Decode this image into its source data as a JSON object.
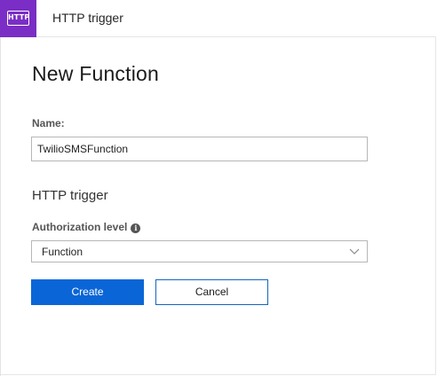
{
  "header": {
    "logo_text": "HTTP",
    "title": "HTTP trigger"
  },
  "form": {
    "page_title": "New Function",
    "name_label": "Name:",
    "name_value": "TwilioSMSFunction",
    "section_title": "HTTP trigger",
    "auth_label": "Authorization level",
    "auth_info_icon": "info-icon",
    "auth_selected": "Function"
  },
  "actions": {
    "create_label": "Create",
    "cancel_label": "Cancel"
  },
  "colors": {
    "logo_bg": "#7a2ec5",
    "primary_button": "#0a66d6",
    "cancel_border": "#1565c0"
  }
}
